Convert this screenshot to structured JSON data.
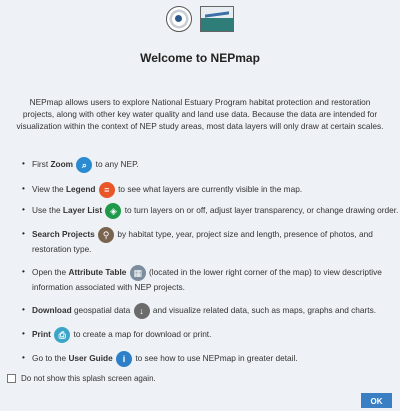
{
  "title": "Welcome to NEPmap",
  "intro": "NEPmap allows users to explore National Estuary Program habitat protection and restoration projects, along with other key water quality and land use data. Because the data are intended for visualization within the context of NEP study areas, most data layers will only draw at certain scales.",
  "items": [
    {
      "pre": "First ",
      "bold": "Zoom",
      "post": " to any NEP.",
      "icon": "zoom-icon"
    },
    {
      "pre": "View the ",
      "bold": "Legend",
      "post": " to see what layers are currently visible in the map.",
      "icon": "legend-icon"
    },
    {
      "pre": "Use the ",
      "bold": "Layer List",
      "post": " to turn layers on or off, adjust layer transparency, or change drawing order.",
      "icon": "layers-icon"
    },
    {
      "pre": "",
      "bold": "Search Projects",
      "post": " by habitat type, year, project size and length, presence of photos, and restoration type.",
      "icon": "search-icon"
    },
    {
      "pre": "Open the ",
      "bold": "Attribute Table",
      "post": " (located in the lower right corner of the map) to view descriptive information associated with NEP projects.",
      "icon": "table-icon"
    },
    {
      "pre": "",
      "bold": "Download",
      "post": " and visualize related data, such as maps, graphs and charts.",
      "mid": " geospatial data ",
      "icon": "download-icon"
    },
    {
      "pre": "",
      "bold": "Print",
      "post": " to create a map for download or print.",
      "icon": "print-icon"
    },
    {
      "pre": "Go to the ",
      "bold": "User Guide",
      "post": " to see how to use NEPmap in greater detail.",
      "icon": "guide-icon"
    }
  ],
  "footer": {
    "checkbox_label": "Do not show this splash screen again.",
    "ok_label": "OK"
  }
}
